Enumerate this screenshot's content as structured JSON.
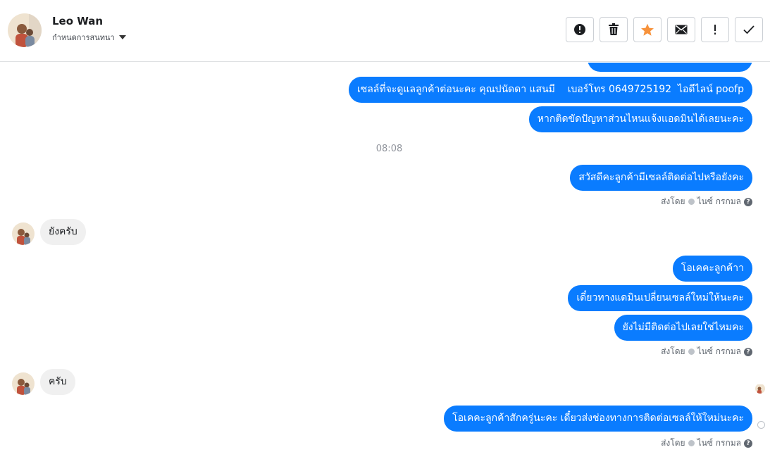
{
  "header": {
    "contact_name": "Leo Wan",
    "assign_label": "กำหนดการสนทนา",
    "toolbar": [
      {
        "icon": "alert-circle-icon",
        "name": "mark-spam-button"
      },
      {
        "icon": "trash-icon",
        "name": "delete-button"
      },
      {
        "icon": "star-icon",
        "name": "star-button"
      },
      {
        "icon": "envelope-icon",
        "name": "mark-unread-button"
      },
      {
        "icon": "exclamation-icon",
        "name": "follow-up-button"
      },
      {
        "icon": "check-icon",
        "name": "mark-done-button"
      }
    ]
  },
  "messages": {
    "m1": "เซลล์ที่จะดูแลลูกค้าต่อนะคะ คุณปนัดดา แสนมี    เบอร์โทร 0649725192  ไอดีไลน์ poofp",
    "m2": "หากติดขัดปัญหาส่วนไหนแจ้งแอดมินได้เลยนะคะ",
    "time1": "08:08",
    "m3": "สวัสดีคะลูกค้ามีเซลล์ติดต่อไปหรือยังคะ",
    "in1": "ยังครับ",
    "m4": "โอเคคะลูกค้าา",
    "m5": "เดี๋ยวทางแดมินเปลี่ยนเซลล์ใหม่ให้นะคะ",
    "m6": "ยังไม่มีติดต่อไปเลยใช่ไหมคะ",
    "in2": "ครับ",
    "m7": "โอเคคะลูกค้าสักครู่นะคะ เดี๋ยวส่งช่องทางการติดต่อเซลล์ให้ใหม่นะคะ"
  },
  "sent_by": {
    "prefix": "ส่งโดย",
    "sender": "ไนซ์ กรกมล",
    "help": "?"
  },
  "colors": {
    "outgoing_bubble": "#0a7cff",
    "incoming_bubble": "#f0f0f0",
    "star": "#f7923b"
  }
}
